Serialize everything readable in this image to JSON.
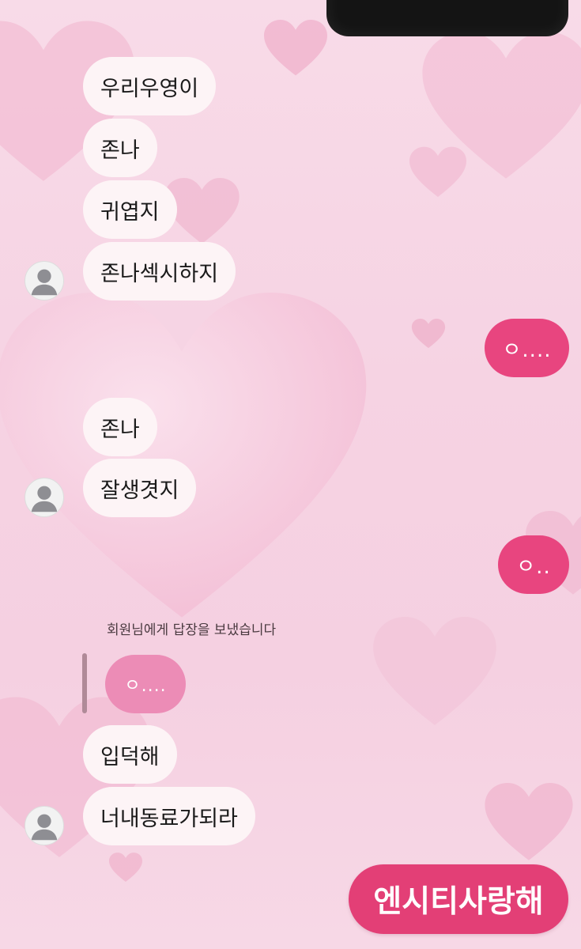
{
  "theme": {
    "received_bubble": "#fdf4f6",
    "sent_bubble": "#e8457f",
    "quoted_bubble": "#ec8cb6",
    "sticker_color": "#e33f76",
    "background": "#f6d3e3"
  },
  "messages": {
    "group1": [
      "우리우영이",
      "존나",
      "귀엽지",
      "존나섹시하지"
    ],
    "sent1": "ㅇ....",
    "group2": [
      "존나",
      "잘생겻지"
    ],
    "sent2": "ㅇ..",
    "reply_note": "회원님에게 답장을 보냈습니다",
    "quoted": "ㅇ....",
    "group3": [
      "입덕해",
      "너내동료가되라"
    ],
    "sticker": "엔시티사랑해"
  },
  "icons": {
    "avatar": "default-profile-icon",
    "background": "heart-icon"
  }
}
